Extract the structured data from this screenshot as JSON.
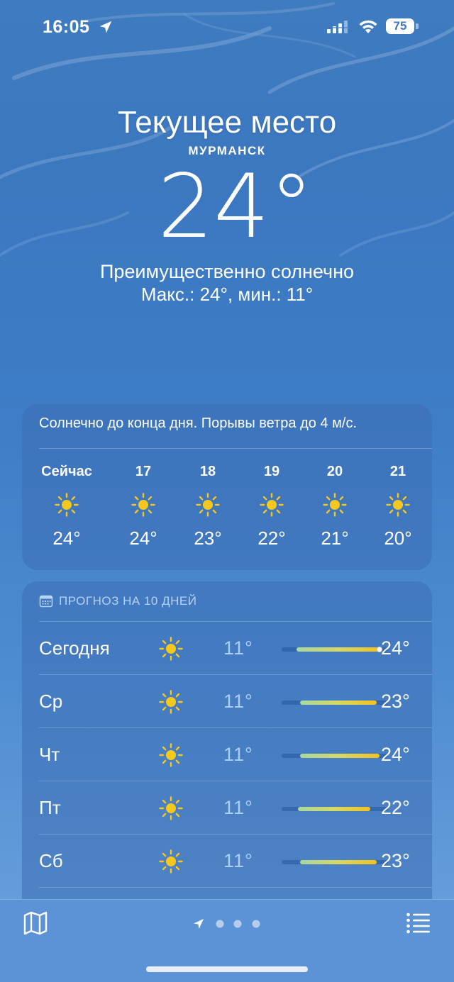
{
  "status_bar": {
    "time": "16:05",
    "battery": "75"
  },
  "hero": {
    "place": "Текущее место",
    "city": "МУРМАНСК",
    "temperature": "24°",
    "condition": "Преимущественно солнечно",
    "hilo": "Макс.: 24°, мин.: 11°"
  },
  "hourly": {
    "summary": "Солнечно до конца дня. Порывы ветра до 4 м/с.",
    "items": [
      {
        "label": "Сейчас",
        "icon": "sun-icon",
        "temp": "24°"
      },
      {
        "label": "17",
        "icon": "sun-icon",
        "temp": "24°"
      },
      {
        "label": "18",
        "icon": "sun-icon",
        "temp": "23°"
      },
      {
        "label": "19",
        "icon": "sun-icon",
        "temp": "22°"
      },
      {
        "label": "20",
        "icon": "sun-icon",
        "temp": "21°"
      },
      {
        "label": "21",
        "icon": "sun-icon",
        "temp": "20°"
      }
    ]
  },
  "daily": {
    "header": "ПРОГНОЗ НА 10 ДНЕЙ",
    "days": [
      {
        "name": "Сегодня",
        "icon": "sun-icon",
        "low": "11°",
        "high": "24°",
        "range_start": 0.14,
        "range_end": 0.92,
        "current": 0.92
      },
      {
        "name": "Ср",
        "icon": "sun-icon",
        "low": "11°",
        "high": "23°",
        "range_start": 0.17,
        "range_end": 0.89
      },
      {
        "name": "Чт",
        "icon": "sun-icon",
        "low": "11°",
        "high": "24°",
        "range_start": 0.17,
        "range_end": 0.92
      },
      {
        "name": "Пт",
        "icon": "sun-icon",
        "low": "11°",
        "high": "22°",
        "range_start": 0.15,
        "range_end": 0.83
      },
      {
        "name": "Сб",
        "icon": "sun-icon",
        "low": "11°",
        "high": "23°",
        "range_start": 0.17,
        "range_end": 0.89
      }
    ]
  },
  "colors": {
    "sun": "#f6c81b",
    "accent_bar_start": "#a8d8a0",
    "accent_bar_end": "#f3c21d"
  },
  "tabbar": {
    "left_icon": "map-icon",
    "right_icon": "list-icon",
    "pages": 3
  }
}
